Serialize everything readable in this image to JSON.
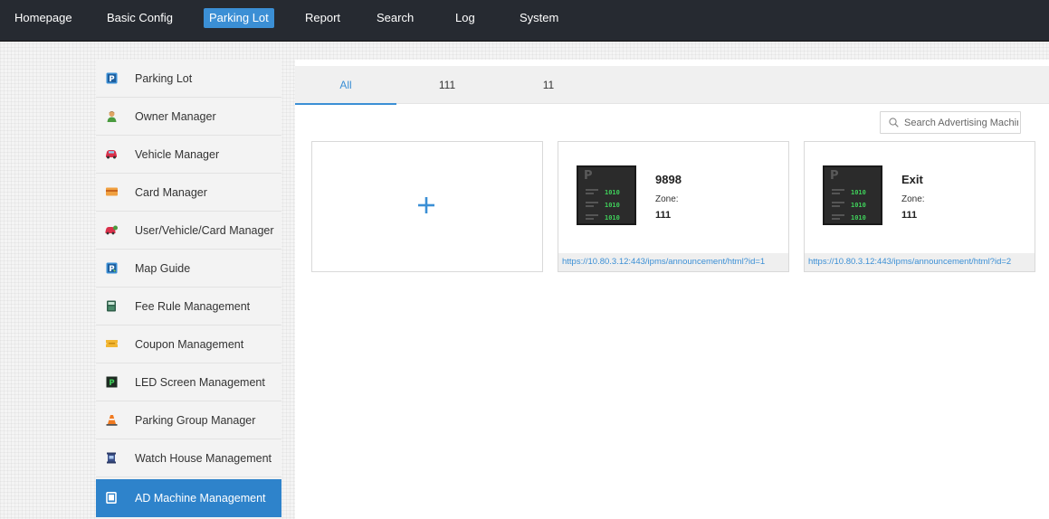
{
  "topnav": {
    "items": [
      {
        "label": "Homepage"
      },
      {
        "label": "Basic Config"
      },
      {
        "label": "Parking Lot",
        "active": true
      },
      {
        "label": "Report"
      },
      {
        "label": "Search"
      },
      {
        "label": "Log"
      },
      {
        "label": "System"
      }
    ]
  },
  "sidebar": {
    "items": [
      {
        "label": "Parking Lot",
        "icon": "parking-p-icon"
      },
      {
        "label": "Owner Manager",
        "icon": "person-icon"
      },
      {
        "label": "Vehicle Manager",
        "icon": "car-icon"
      },
      {
        "label": "Card Manager",
        "icon": "card-icon"
      },
      {
        "label": "User/Vehicle/Card Manager",
        "icon": "user-vehicle-card-icon"
      },
      {
        "label": "Map Guide",
        "icon": "map-guide-icon"
      },
      {
        "label": "Fee Rule Management",
        "icon": "fee-rule-icon"
      },
      {
        "label": "Coupon Management",
        "icon": "coupon-icon"
      },
      {
        "label": "LED Screen Management",
        "icon": "led-screen-icon"
      },
      {
        "label": "Parking Group Manager",
        "icon": "traffic-cone-icon"
      },
      {
        "label": "Watch House Management",
        "icon": "watch-house-icon"
      },
      {
        "label": "AD Machine Management",
        "icon": "ad-machine-icon",
        "active": true
      }
    ]
  },
  "tabs": [
    {
      "label": "All",
      "active": true
    },
    {
      "label": "111"
    },
    {
      "label": "11"
    }
  ],
  "search": {
    "placeholder": "Search Advertising Machine"
  },
  "cards": [
    {
      "name": "9898",
      "zone_label": "Zone:",
      "zone": "111",
      "url": "https://10.80.3.12:443/ipms/announcement/html?id=1"
    },
    {
      "name": "Exit",
      "zone_label": "Zone:",
      "zone": "111",
      "url": "https://10.80.3.12:443/ipms/announcement/html?id=2"
    }
  ],
  "colors": {
    "accent": "#3b8fd5",
    "nav_bg": "#262a31",
    "active_side": "#2e83cb"
  }
}
